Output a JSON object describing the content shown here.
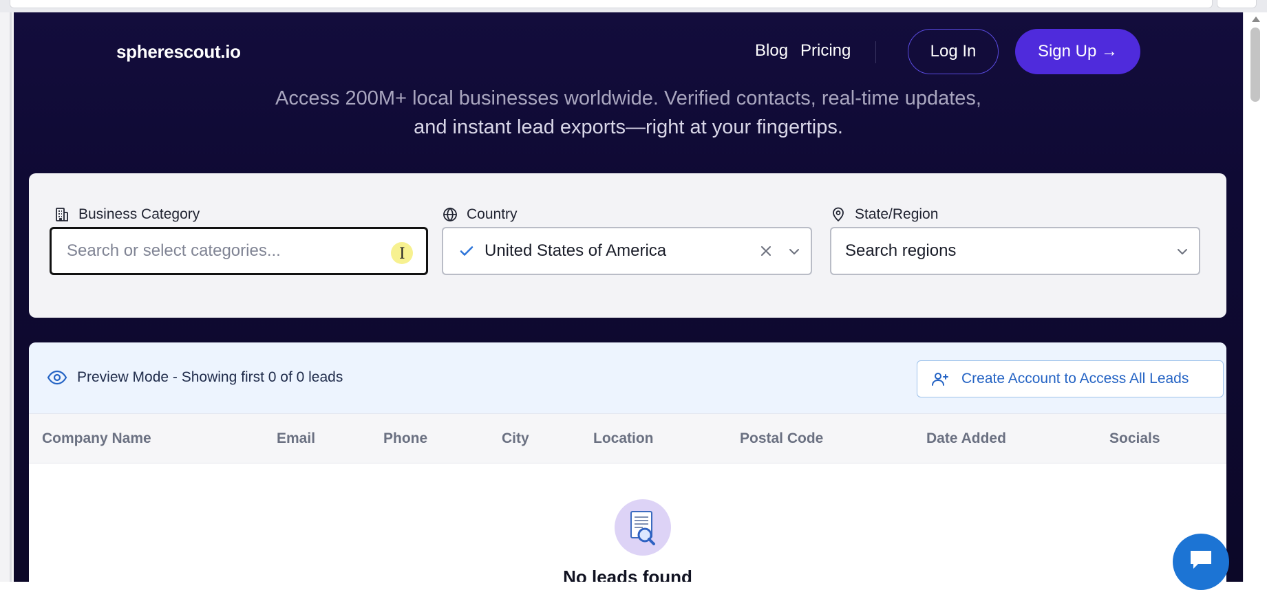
{
  "nav": {
    "logo": "spherescout.io",
    "links": [
      "Blog",
      "Pricing"
    ],
    "login_label": "Log In",
    "signup_label": "Sign Up →"
  },
  "hero": {
    "subtitle_line1": "Access 200M+ local businesses worldwide. Verified contacts, real-time updates,",
    "subtitle_line2": "and instant lead exports—right at your fingertips."
  },
  "filters": {
    "category": {
      "label": "Business Category",
      "placeholder": "Search or select categories...",
      "value": "",
      "icon": "building-icon"
    },
    "country": {
      "label": "Country",
      "value": "United States of America",
      "icon": "globe-icon"
    },
    "region": {
      "label": "State/Region",
      "value": "Search regions",
      "icon": "map-pin-icon"
    }
  },
  "results": {
    "preview_text": "Preview Mode - Showing first 0 of 0 leads",
    "create_account_label": "Create Account to Access All Leads",
    "columns": [
      "Company Name",
      "Email",
      "Phone",
      "City",
      "Location",
      "Postal Code",
      "Date Added",
      "Socials"
    ],
    "empty_title": "No leads found"
  },
  "colors": {
    "page_bg": "#130d3c",
    "accent": "#4f2bdc",
    "link_blue": "#2463c4",
    "check_blue": "#2d74d8"
  }
}
